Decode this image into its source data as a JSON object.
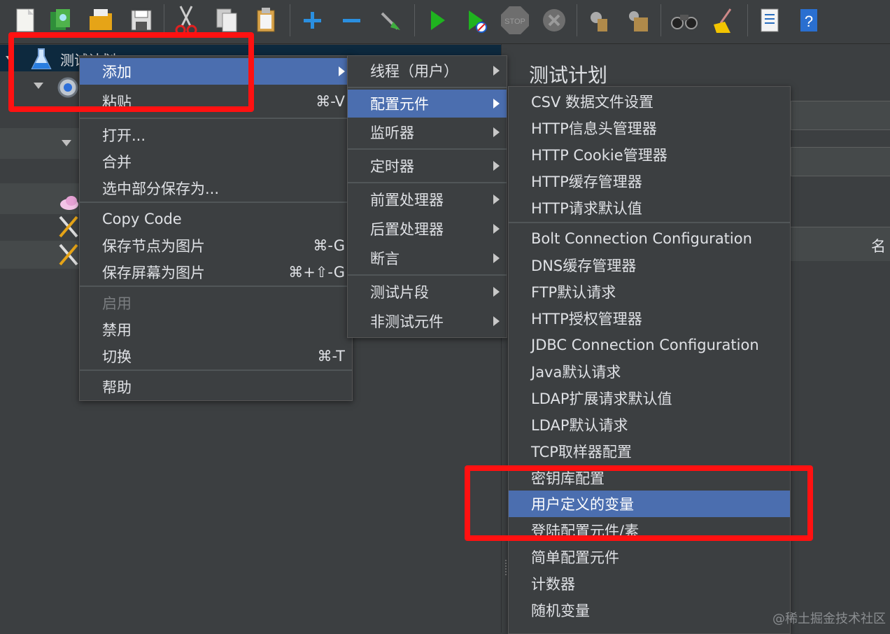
{
  "tree": {
    "root_label": "测试计划"
  },
  "right_panel": {
    "title": "测试计划",
    "name_label_partial": "名"
  },
  "context_menu": {
    "items": [
      {
        "label": "添加",
        "submenu": true,
        "selected": true
      },
      {
        "label": "粘贴",
        "shortcut": "⌘-V"
      },
      {
        "label": "打开..."
      },
      {
        "label": "合并"
      },
      {
        "label": "选中部分保存为..."
      },
      {
        "label": "Copy Code"
      },
      {
        "label": "保存节点为图片",
        "shortcut": "⌘-G"
      },
      {
        "label": "保存屏幕为图片",
        "shortcut": "⌘+⇧-G"
      },
      {
        "label": "启用",
        "disabled": true
      },
      {
        "label": "禁用"
      },
      {
        "label": "切换",
        "shortcut": "⌘-T"
      },
      {
        "label": "帮助"
      }
    ]
  },
  "add_submenu": {
    "items": [
      {
        "label": "线程（用户）"
      },
      {
        "label": "配置元件",
        "selected": true
      },
      {
        "label": "监听器"
      },
      {
        "label": "定时器"
      },
      {
        "label": "前置处理器"
      },
      {
        "label": "后置处理器"
      },
      {
        "label": "断言"
      },
      {
        "label": "测试片段"
      },
      {
        "label": "非测试元件"
      }
    ]
  },
  "config_submenu": {
    "items": [
      {
        "label": "CSV 数据文件设置"
      },
      {
        "label": "HTTP信息头管理器"
      },
      {
        "label": "HTTP Cookie管理器"
      },
      {
        "label": "HTTP缓存管理器"
      },
      {
        "label": "HTTP请求默认值"
      },
      {
        "label": "Bolt Connection Configuration"
      },
      {
        "label": "DNS缓存管理器"
      },
      {
        "label": "FTP默认请求"
      },
      {
        "label": "HTTP授权管理器"
      },
      {
        "label": "JDBC Connection Configuration"
      },
      {
        "label": "Java默认请求"
      },
      {
        "label": "LDAP扩展请求默认值"
      },
      {
        "label": "LDAP默认请求"
      },
      {
        "label": "TCP取样器配置"
      },
      {
        "label": "密钥库配置"
      },
      {
        "label": "用户定义的变量",
        "selected": true
      },
      {
        "label": "登陆配置元件/素"
      },
      {
        "label": "简单配置元件"
      },
      {
        "label": "计数器"
      },
      {
        "label": "随机变量"
      }
    ]
  },
  "watermark": "@稀土掘金技术社区",
  "colors": {
    "background": "#3c3f41",
    "selection": "#4b6eaf",
    "highlight_box": "#ff1111"
  }
}
